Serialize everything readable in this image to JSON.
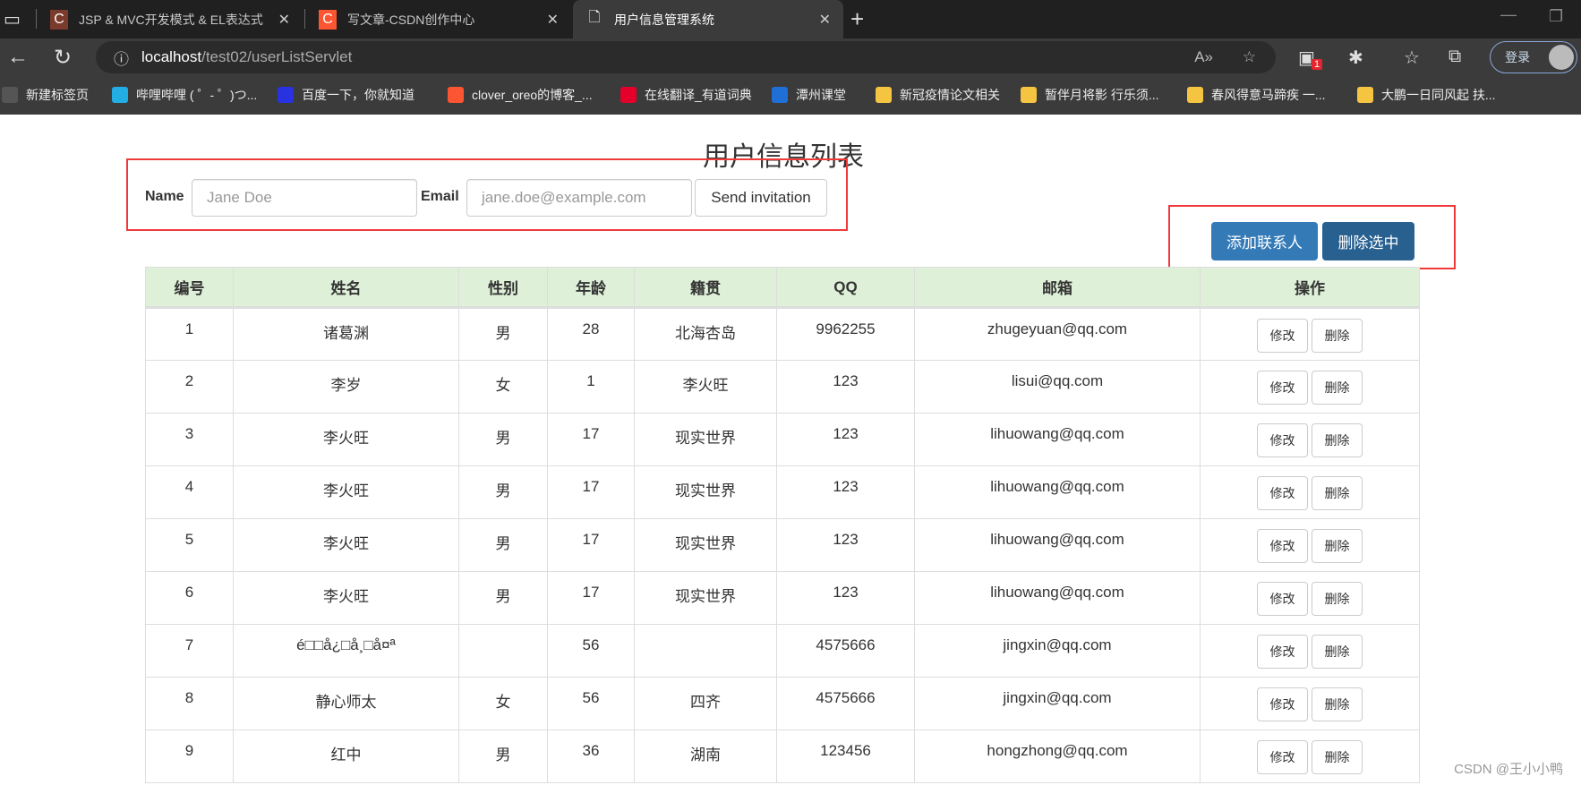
{
  "browser": {
    "tabs": [
      {
        "title": "JSP & MVC开发模式 & EL表达式",
        "icon": "csdn-icon"
      },
      {
        "title": "写文章-CSDN创作中心",
        "icon": "csdn-icon"
      },
      {
        "title": "用户信息管理系统",
        "icon": "page-icon"
      }
    ],
    "url_host": "localhost",
    "url_path": "/test02/userListServlet",
    "extension_badge": "1",
    "login_label": "登录",
    "bookmarks": [
      "新建标签页",
      "哔哩哔哩 ( ゜- ゜)つ...",
      "百度一下，你就知道",
      "clover_oreo的博客_...",
      "在线翻译_有道词典",
      "潭州课堂",
      "新冠疫情论文相关",
      "暂伴月将影 行乐须...",
      "春风得意马蹄疾 一...",
      "大鹏一日同风起 扶..."
    ]
  },
  "page": {
    "title": "用户信息列表",
    "form": {
      "name_label": "Name",
      "name_placeholder": "Jane Doe",
      "email_label": "Email",
      "email_placeholder": "jane.doe@example.com",
      "submit": "Send invitation"
    },
    "add_button": "添加联系人",
    "delete_selected_button": "删除选中",
    "accent_color": "#337ab7",
    "table": {
      "headers": [
        "编号",
        "姓名",
        "性别",
        "年龄",
        "籍贯",
        "QQ",
        "邮箱",
        "操作"
      ],
      "edit_label": "修改",
      "delete_label": "删除",
      "rows": [
        [
          "1",
          "诸葛渊",
          "男",
          "28",
          "北海杏岛",
          "9962255",
          "zhugeyuan@qq.com"
        ],
        [
          "2",
          "李岁",
          "女",
          "1",
          "李火旺",
          "123",
          "lisui@qq.com"
        ],
        [
          "3",
          "李火旺",
          "男",
          "17",
          "现实世界",
          "123",
          "lihuowang@qq.com"
        ],
        [
          "4",
          "李火旺",
          "男",
          "17",
          "现实世界",
          "123",
          "lihuowang@qq.com"
        ],
        [
          "5",
          "李火旺",
          "男",
          "17",
          "现实世界",
          "123",
          "lihuowang@qq.com"
        ],
        [
          "6",
          "李火旺",
          "男",
          "17",
          "现实世界",
          "123",
          "lihuowang@qq.com"
        ],
        [
          "7",
          "é□□å¿□å¸□å¤ª",
          "",
          "56",
          "",
          "4575666",
          "jingxin@qq.com"
        ],
        [
          "8",
          "静心师太",
          "女",
          "56",
          "四齐",
          "4575666",
          "jingxin@qq.com"
        ],
        [
          "9",
          "红中",
          "男",
          "36",
          "湖南",
          "123456",
          "hongzhong@qq.com"
        ]
      ]
    },
    "watermark": "CSDN @王小小鸭"
  }
}
